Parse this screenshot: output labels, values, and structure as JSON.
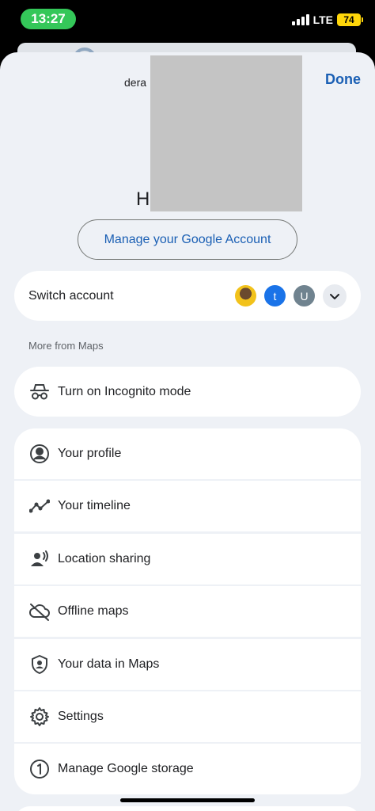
{
  "status_bar": {
    "time": "13:27",
    "network": "LTE",
    "battery": "74"
  },
  "header": {
    "email_prefix": "dera",
    "done_label": "Done",
    "greeting_prefix": "H"
  },
  "manage_account_label": "Manage your Google Account",
  "switch_account": {
    "label": "Switch account",
    "avatars": [
      {
        "type": "photo",
        "letter": ""
      },
      {
        "type": "letter",
        "letter": "t",
        "color": "#1a73e8"
      },
      {
        "type": "letter",
        "letter": "U",
        "color": "#70838f"
      }
    ]
  },
  "section_header": "More from Maps",
  "incognito": {
    "label": "Turn on Incognito mode",
    "icon": "incognito-icon"
  },
  "menu": [
    {
      "label": "Your profile",
      "icon": "profile-icon"
    },
    {
      "label": "Your timeline",
      "icon": "timeline-icon"
    },
    {
      "label": "Location sharing",
      "icon": "location-sharing-icon"
    },
    {
      "label": "Offline maps",
      "icon": "offline-maps-icon"
    },
    {
      "label": "Your data in Maps",
      "icon": "data-shield-icon"
    },
    {
      "label": "Settings",
      "icon": "settings-gear-icon"
    },
    {
      "label": "Manage Google storage",
      "icon": "storage-icon"
    }
  ],
  "colors": {
    "accent": "#1a5fb4",
    "sheet_bg": "#eef1f6",
    "status_green": "#34c759",
    "battery_yellow": "#ffd60a"
  }
}
